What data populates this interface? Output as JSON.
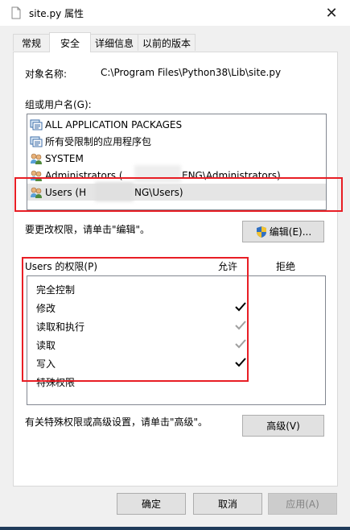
{
  "window": {
    "title": "site.py 属性",
    "close_glyph": "✕"
  },
  "tabs": [
    {
      "label": "常规",
      "active": false
    },
    {
      "label": "安全",
      "active": true
    },
    {
      "label": "详细信息",
      "active": false
    },
    {
      "label": "以前的版本",
      "active": false
    }
  ],
  "security": {
    "object_name_label": "对象名称:",
    "object_name_value": "C:\\Program Files\\Python38\\Lib\\site.py",
    "groups_label": "组或用户名(G):",
    "groups": [
      {
        "icon": "package-group-icon",
        "name": "ALL APPLICATION PACKAGES",
        "selected": false
      },
      {
        "icon": "package-group-icon",
        "name": "所有受限制的应用程序包",
        "selected": false
      },
      {
        "icon": "user-group-icon",
        "name": "SYSTEM",
        "selected": false
      },
      {
        "icon": "user-group-icon",
        "name": "Administrators (",
        "name_tail": "ENG\\Administrators)",
        "selected": false
      },
      {
        "icon": "user-group-icon",
        "name": "Users (H",
        "name_tail": "NG\\Users)",
        "selected": true
      }
    ],
    "change_hint": "要更改权限，请单击\"编辑\"。",
    "edit_button": "编辑(E)...",
    "perm_header": "Users 的权限(P)",
    "allow_header": "允许",
    "deny_header": "拒绝",
    "permissions": [
      {
        "name": "完全控制",
        "allow": "none"
      },
      {
        "name": "修改",
        "allow": "checked"
      },
      {
        "name": "读取和执行",
        "allow": "checked-gray"
      },
      {
        "name": "读取",
        "allow": "checked-gray"
      },
      {
        "name": "写入",
        "allow": "checked"
      },
      {
        "name": "特殊权限",
        "allow": "none"
      }
    ],
    "advanced_hint": "有关特殊权限或高级设置，请单击\"高级\"。",
    "advanced_button": "高级(V)"
  },
  "footer": {
    "ok": "确定",
    "cancel": "取消",
    "apply": "应用(A)"
  },
  "colors": {
    "highlight_red": "#e81e25",
    "selected_row": "#e5e5e5"
  }
}
